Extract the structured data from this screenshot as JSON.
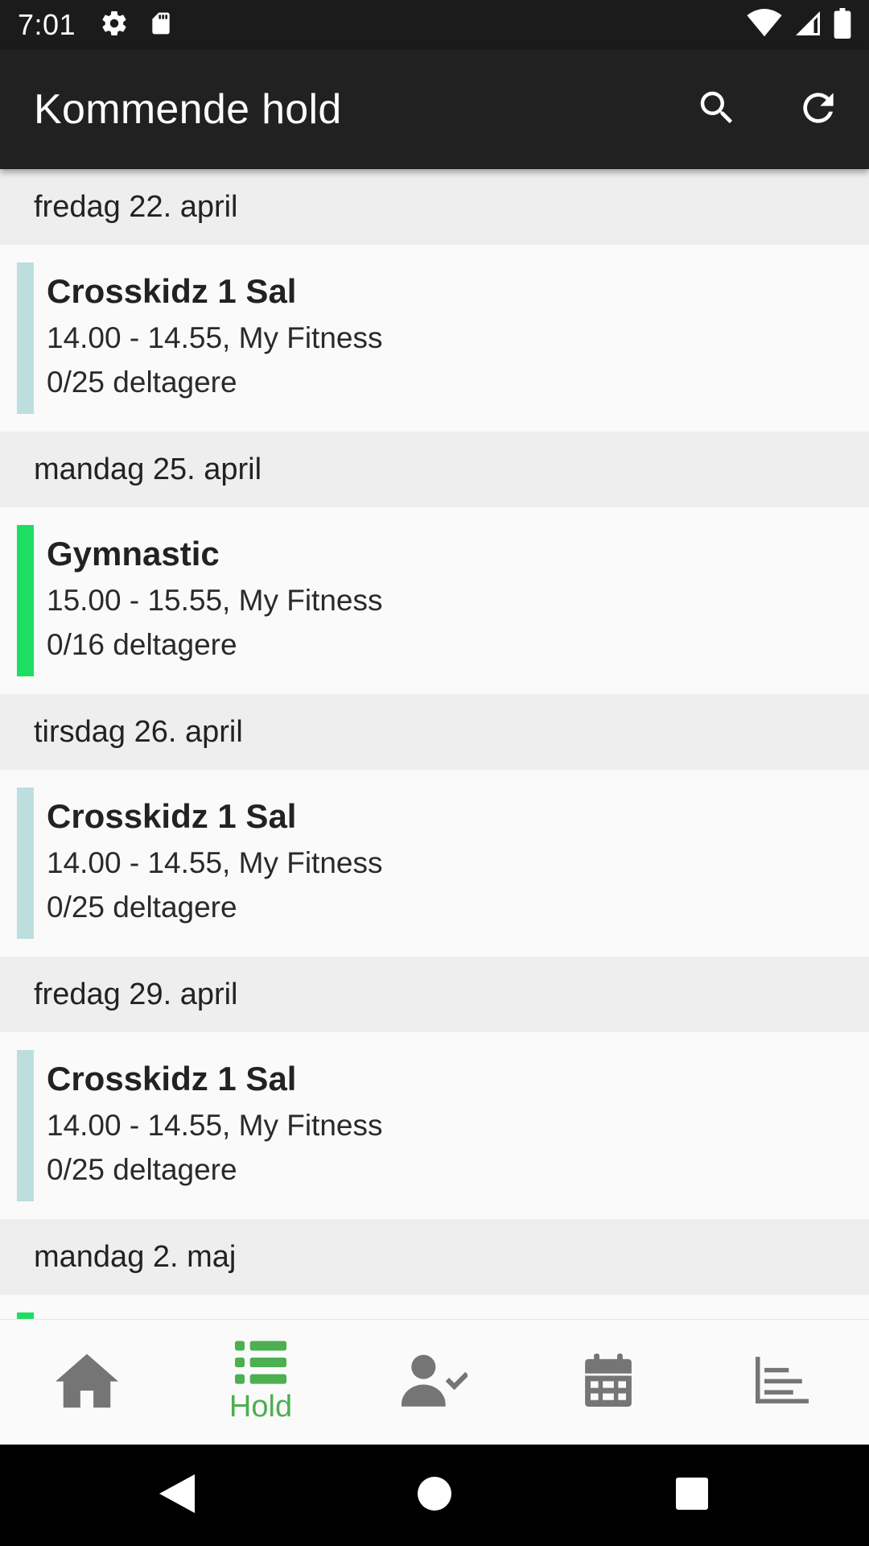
{
  "status_bar": {
    "time": "7:01",
    "icons": [
      "settings-icon",
      "sd-card-icon",
      "wifi-icon",
      "signal-icon",
      "battery-icon"
    ]
  },
  "app_bar": {
    "title": "Kommende hold",
    "actions": [
      "search-icon",
      "refresh-icon"
    ]
  },
  "colors": {
    "app_bar": "#212121",
    "status_bar": "#1b1b1b",
    "accent_green": "#4caf50",
    "crosskidz": "#bcdedf",
    "gymnastic": "#1ede62",
    "date_header_bg": "#eeeeee"
  },
  "schedule": [
    {
      "date": "fredag 22. april",
      "sessions": [
        {
          "name": "Crosskidz 1 Sal",
          "time_place": "14.00 - 14.55, My Fitness",
          "participants": "0/25 deltagere",
          "color": "#bcdedf"
        }
      ]
    },
    {
      "date": "mandag 25. april",
      "sessions": [
        {
          "name": "Gymnastic",
          "time_place": "15.00 - 15.55, My Fitness",
          "participants": "0/16 deltagere",
          "color": "#1ede62"
        }
      ]
    },
    {
      "date": "tirsdag 26. april",
      "sessions": [
        {
          "name": "Crosskidz 1 Sal",
          "time_place": "14.00 - 14.55, My Fitness",
          "participants": "0/25 deltagere",
          "color": "#bcdedf"
        }
      ]
    },
    {
      "date": "fredag 29. april",
      "sessions": [
        {
          "name": "Crosskidz 1 Sal",
          "time_place": "14.00 - 14.55, My Fitness",
          "participants": "0/25 deltagere",
          "color": "#bcdedf"
        }
      ]
    },
    {
      "date": "mandag 2. maj",
      "sessions": [
        {
          "color": "#1ede62"
        }
      ]
    }
  ],
  "bottom_nav": {
    "items": [
      {
        "icon": "home-icon",
        "label": ""
      },
      {
        "icon": "list-icon",
        "label": "Hold",
        "active": true
      },
      {
        "icon": "person-check-icon",
        "label": ""
      },
      {
        "icon": "calendar-icon",
        "label": ""
      },
      {
        "icon": "stats-icon",
        "label": ""
      }
    ]
  },
  "system_nav": [
    "back-icon",
    "home-circle-icon",
    "recents-icon"
  ]
}
